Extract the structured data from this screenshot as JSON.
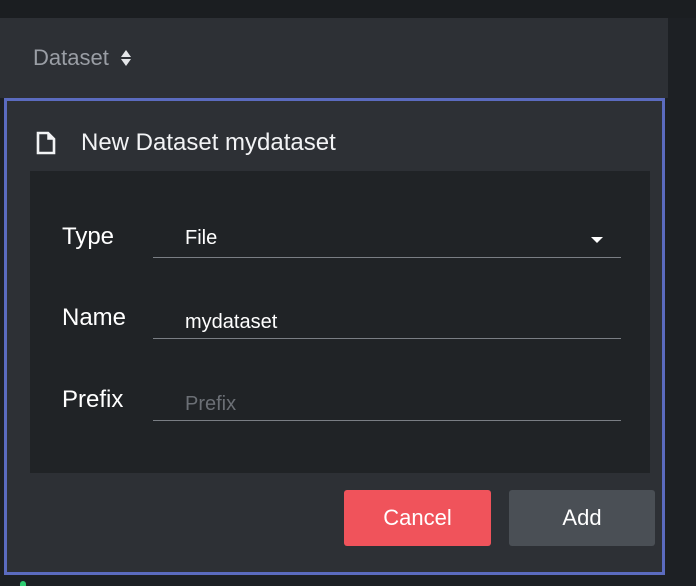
{
  "header": {
    "label": "Dataset",
    "sort_icon": "sort-icon"
  },
  "panel": {
    "icon": "file-icon",
    "title": "New Dataset mydataset",
    "accent_color": "#5b6bbf"
  },
  "form": {
    "type": {
      "label": "Type",
      "value": "File",
      "icon": "chevron-down-icon"
    },
    "name": {
      "label": "Name",
      "value": "mydataset"
    },
    "prefix": {
      "label": "Prefix",
      "value": "",
      "placeholder": "Prefix"
    }
  },
  "buttons": {
    "cancel_label": "Cancel",
    "cancel_color": "#f0535b",
    "add_label": "Add",
    "add_color": "#4a4f55"
  }
}
